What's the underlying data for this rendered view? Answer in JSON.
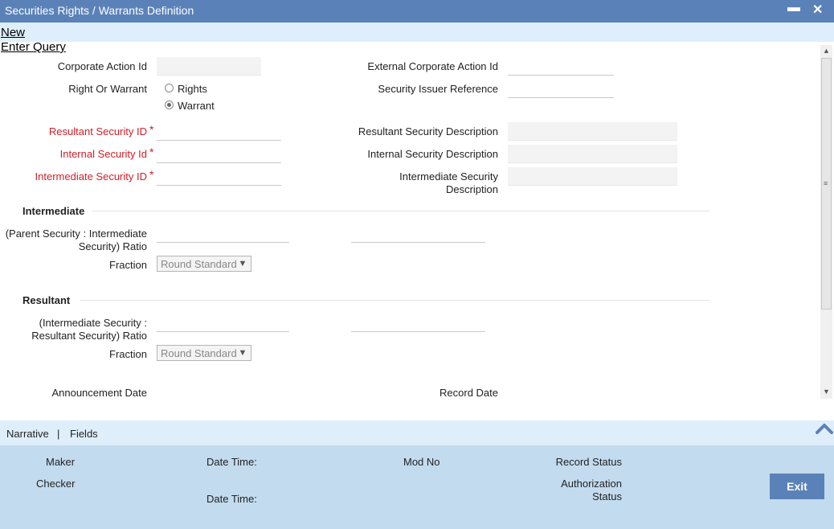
{
  "window": {
    "title": "Securities Rights / Warrants Definition",
    "minimize": "▬",
    "close": "✕"
  },
  "menu": {
    "new": "New",
    "enter_query": "Enter Query"
  },
  "form": {
    "corporate_action_id": "Corporate Action Id",
    "external_corporate_action_id": "External Corporate Action Id",
    "right_or_warrant": "Right Or Warrant",
    "rights": "Rights",
    "warrant": "Warrant",
    "selected": "Warrant",
    "security_issuer_reference": "Security Issuer Reference",
    "resultant_security_id": "Resultant Security ID",
    "resultant_security_description": "Resultant Security Description",
    "internal_security_id": "Internal Security Id",
    "internal_security_description": "Internal Security Description",
    "intermediate_security_id": "Intermediate Security ID",
    "intermediate_security_description_1": "Intermediate Security",
    "intermediate_security_description_2": "Description",
    "required_mark": "*"
  },
  "intermediate": {
    "heading": "Intermediate",
    "ratio_label_1": "(Parent Security : Intermediate",
    "ratio_label_2": "Security) Ratio",
    "fraction_label": "Fraction",
    "fraction_value": "Round Standard"
  },
  "resultant": {
    "heading": "Resultant",
    "ratio_label_1": "(Intermediate Security :",
    "ratio_label_2": "Resultant Security) Ratio",
    "fraction_label": "Fraction",
    "fraction_value": "Round Standard"
  },
  "dates": {
    "announcement_date": "Announcement Date",
    "record_date": "Record Date"
  },
  "tabs": {
    "narrative": "Narrative",
    "separator": "|",
    "fields": "Fields"
  },
  "footer": {
    "maker": "Maker",
    "checker": "Checker",
    "date_time_1": "Date Time:",
    "date_time_2": "Date Time:",
    "mod_no": "Mod No",
    "record_status": "Record Status",
    "authorization_status_1": "Authorization",
    "authorization_status_2": "Status",
    "exit": "Exit"
  },
  "colors": {
    "title_bar": "#5b82b8",
    "required": "#d0202a",
    "footer": "#c3dbee"
  }
}
